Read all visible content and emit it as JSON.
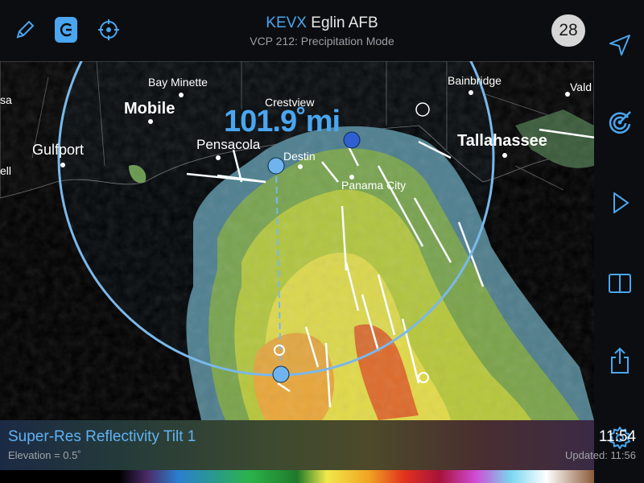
{
  "header": {
    "station_code": "KEVX",
    "station_name": "Eglin AFB",
    "vcp": "VCP 212: Precipitation Mode",
    "count": "28"
  },
  "toolbar_left": [
    {
      "icon": "pencil-icon"
    },
    {
      "icon": "measure-tool-icon"
    },
    {
      "icon": "crosshair-icon"
    }
  ],
  "sidebar": [
    {
      "icon": "location-arrow-icon"
    },
    {
      "icon": "radar-target-icon"
    },
    {
      "icon": "play-icon"
    },
    {
      "icon": "split-view-icon"
    },
    {
      "icon": "share-icon"
    },
    {
      "icon": "gear-icon"
    }
  ],
  "map": {
    "range_readout": "101.9˚mi",
    "cities": [
      {
        "label": "Bay Minette"
      },
      {
        "label": "Mobile"
      },
      {
        "label": "Crestview"
      },
      {
        "label": "Pensacola"
      },
      {
        "label": "Destin"
      },
      {
        "label": "Gulfport"
      },
      {
        "label": "Panama City"
      },
      {
        "label": "Tallahassee"
      },
      {
        "label": "Bainbridge"
      },
      {
        "label": "Vald"
      },
      {
        "label": "sa"
      },
      {
        "label": "ell"
      }
    ]
  },
  "legend": {
    "product": "Super-Res Reflectivity Tilt 1",
    "elevation": "Elevation = 0.5˚",
    "time": "11:54",
    "updated": "Updated: 11:56"
  },
  "colors": {
    "accent": "#4aa6f0",
    "background": "#000000",
    "bar": "#0c0d10"
  }
}
